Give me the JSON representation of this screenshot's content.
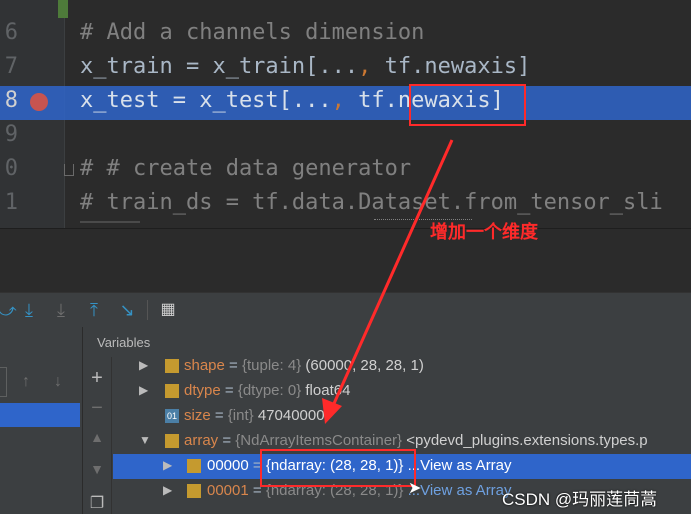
{
  "editor": {
    "line_numbers": [
      "6",
      "7",
      "8",
      "9",
      "0",
      "1"
    ],
    "lines": [
      {
        "comment": "# Add a channels dimension"
      },
      {
        "pre": "x_train = x_train[",
        "mid": "...",
        "kw": ",",
        "post": " tf.newaxis]"
      },
      {
        "pre": "x_test = x_test[",
        "mid": "...",
        "kw": ",",
        "post": " tf.",
        "boxed": "newaxis",
        "end": "]"
      },
      {
        "blank": ""
      },
      {
        "comment": "# # create data generator"
      },
      {
        "comment": "# train_ds = tf.data.Dataset.from_tensor_sli"
      }
    ]
  },
  "annotation": {
    "text": "增加一个维度",
    "color": "#ff2a2a"
  },
  "debugger": {
    "toolbar_icons": [
      "step-over-icon",
      "step-into-icon",
      "step-into-my-code-icon",
      "step-out-icon",
      "run-to-cursor-icon",
      "evaluate-expression-icon"
    ],
    "panel_title": "Variables",
    "variables": [
      {
        "name": "shape",
        "type": "{tuple: 4}",
        "value": "(60000, 28, 28, 1)",
        "expandable": true
      },
      {
        "name": "dtype",
        "type": "{dtype: 0}",
        "value": "float64",
        "expandable": true
      },
      {
        "name": "size",
        "type": "{int}",
        "value": "47040000",
        "expandable": false
      },
      {
        "name": "array",
        "type": "{NdArrayItemsContainer}",
        "value": "<pydevd_plugins.extensions.types.p",
        "expandable": true,
        "expanded": true
      },
      {
        "name": "00000",
        "type": "{ndarray: (28, 28, 1)}",
        "value": "",
        "link": "...View as Array",
        "expandable": true,
        "selected": true
      },
      {
        "name": "00001",
        "type": "{ndarray: (28, 28, 1)}",
        "value": "",
        "link": "...View as Array",
        "expandable": true
      }
    ]
  },
  "watermark": "CSDN @玛丽莲茼蒿"
}
